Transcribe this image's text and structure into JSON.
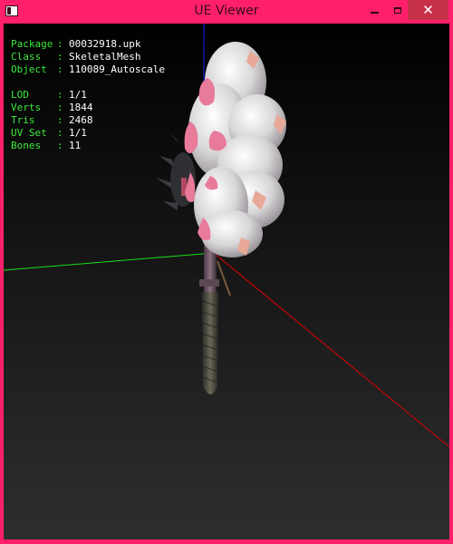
{
  "window": {
    "title": "UE Viewer",
    "close_glyph": "✕"
  },
  "colors": {
    "frame": "#ff1f6a",
    "close_button": "#c8314a",
    "label_green": "#3bea3b",
    "value_white": "#ffffff",
    "axis_x": "#ff0000",
    "axis_y": "#00ff00",
    "axis_z": "#0000ff"
  },
  "info": {
    "object": [
      {
        "key": "Package",
        "value": "00032918.upk"
      },
      {
        "key": "Class",
        "value": "SkeletalMesh"
      },
      {
        "key": "Object",
        "value": "110089_Autoscale"
      }
    ],
    "stats": [
      {
        "key": "LOD",
        "value": "1/1"
      },
      {
        "key": "Verts",
        "value": "1844"
      },
      {
        "key": "Tris",
        "value": "2468"
      },
      {
        "key": "UV Set",
        "value": "1/1"
      },
      {
        "key": "Bones",
        "value": "11"
      }
    ],
    "separator": ":"
  },
  "icons": {
    "app": "app-icon",
    "minimize": "minimize-icon",
    "maximize": "maximize-icon",
    "close": "close-icon"
  }
}
